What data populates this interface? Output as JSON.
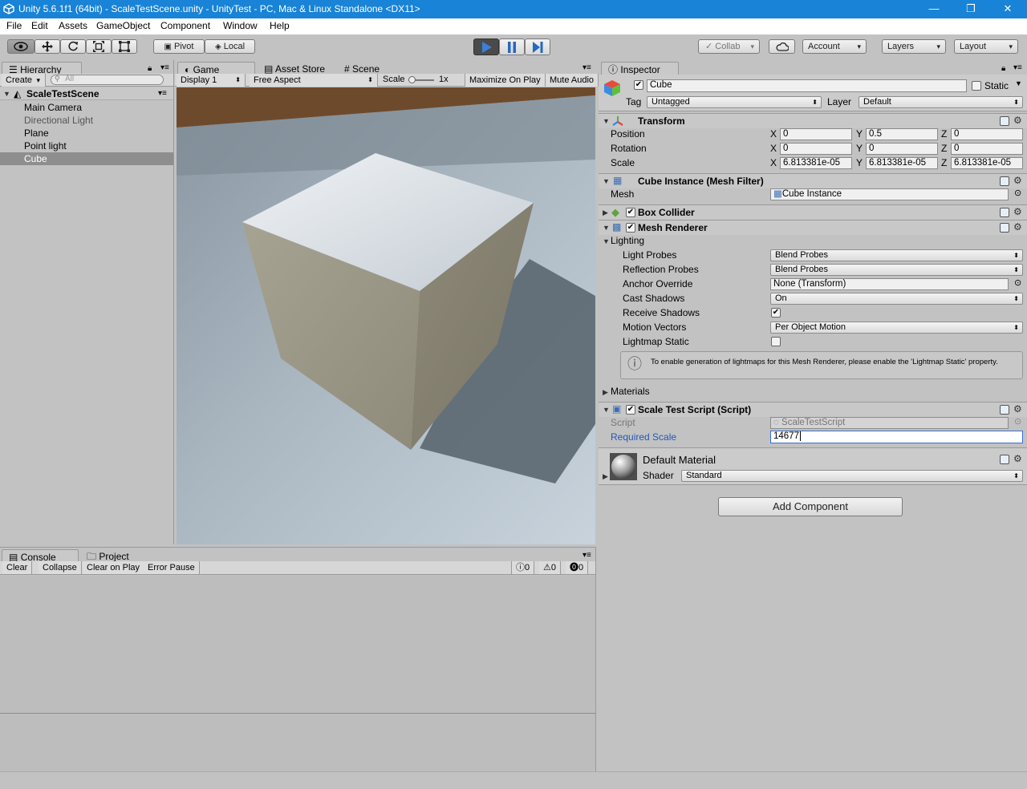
{
  "window": {
    "title": "Unity 5.6.1f1 (64bit) - ScaleTestScene.unity - UnityTest - PC, Mac & Linux Standalone <DX11>",
    "minimize": "—",
    "restore": "❐",
    "close": "✕"
  },
  "menu": [
    "File",
    "Edit",
    "Assets",
    "GameObject",
    "Component",
    "Window",
    "Help"
  ],
  "toolbar": {
    "pivot": "Pivot",
    "local": "Local",
    "collab": "Collab",
    "account": "Account",
    "layers": "Layers",
    "layout": "Layout",
    "play_color": "#3c7fd8"
  },
  "hierarchy": {
    "tab": "Hierarchy",
    "create": "Create",
    "search_placeholder": "All",
    "scene": "ScaleTestScene",
    "items": [
      {
        "label": "Main Camera"
      },
      {
        "label": "Directional Light"
      },
      {
        "label": "Plane"
      },
      {
        "label": "Point light"
      },
      {
        "label": "Cube"
      }
    ]
  },
  "game": {
    "tabs": [
      "Game",
      "Asset Store",
      "Scene"
    ],
    "display": "Display 1",
    "aspect": "Free Aspect",
    "scale_label": "Scale",
    "scale_value": "1x",
    "maximize": "Maximize On Play",
    "mute": "Mute Audio"
  },
  "console": {
    "tabs": [
      "Console",
      "Project"
    ],
    "buttons": [
      "Clear",
      "Collapse",
      "Clear on Play",
      "Error Pause"
    ],
    "counts": [
      "0",
      "0",
      "0"
    ]
  },
  "inspector": {
    "tab": "Inspector",
    "name": "Cube",
    "static_label": "Static",
    "tag_label": "Tag",
    "tag": "Untagged",
    "layer_label": "Layer",
    "layer": "Default",
    "transform": {
      "title": "Transform",
      "rows": [
        {
          "label": "Position",
          "x": "0",
          "y": "0.5",
          "z": "0"
        },
        {
          "label": "Rotation",
          "x": "0",
          "y": "0",
          "z": "0"
        },
        {
          "label": "Scale",
          "x": "6.813381e-05",
          "y": "6.813381e-05",
          "z": "6.813381e-05"
        }
      ]
    },
    "mesh_filter": {
      "title": "Cube Instance (Mesh Filter)",
      "mesh_label": "Mesh",
      "mesh": "Cube Instance"
    },
    "box_collider": {
      "title": "Box Collider"
    },
    "mesh_renderer": {
      "title": "Mesh Renderer",
      "lighting": "Lighting",
      "rows": [
        {
          "label": "Light Probes",
          "value": "Blend Probes"
        },
        {
          "label": "Reflection Probes",
          "value": "Blend Probes"
        },
        {
          "label": "Anchor Override",
          "value": "None (Transform)"
        },
        {
          "label": "Cast Shadows",
          "value": "On"
        },
        {
          "label": "Receive Shadows",
          "value": "✔"
        },
        {
          "label": "Motion Vectors",
          "value": "Per Object Motion"
        },
        {
          "label": "Lightmap Static",
          "value": ""
        }
      ],
      "info": "To enable generation of lightmaps for this Mesh Renderer, please enable the 'Lightmap Static' property.",
      "materials": "Materials"
    },
    "script": {
      "title": "Scale Test Script (Script)",
      "script_label": "Script",
      "script": "ScaleTestScript",
      "required_label": "Required Scale",
      "required_value": "14677"
    },
    "material": {
      "name": "Default Material",
      "shader_label": "Shader",
      "shader": "Standard"
    },
    "add_component": "Add Component"
  }
}
